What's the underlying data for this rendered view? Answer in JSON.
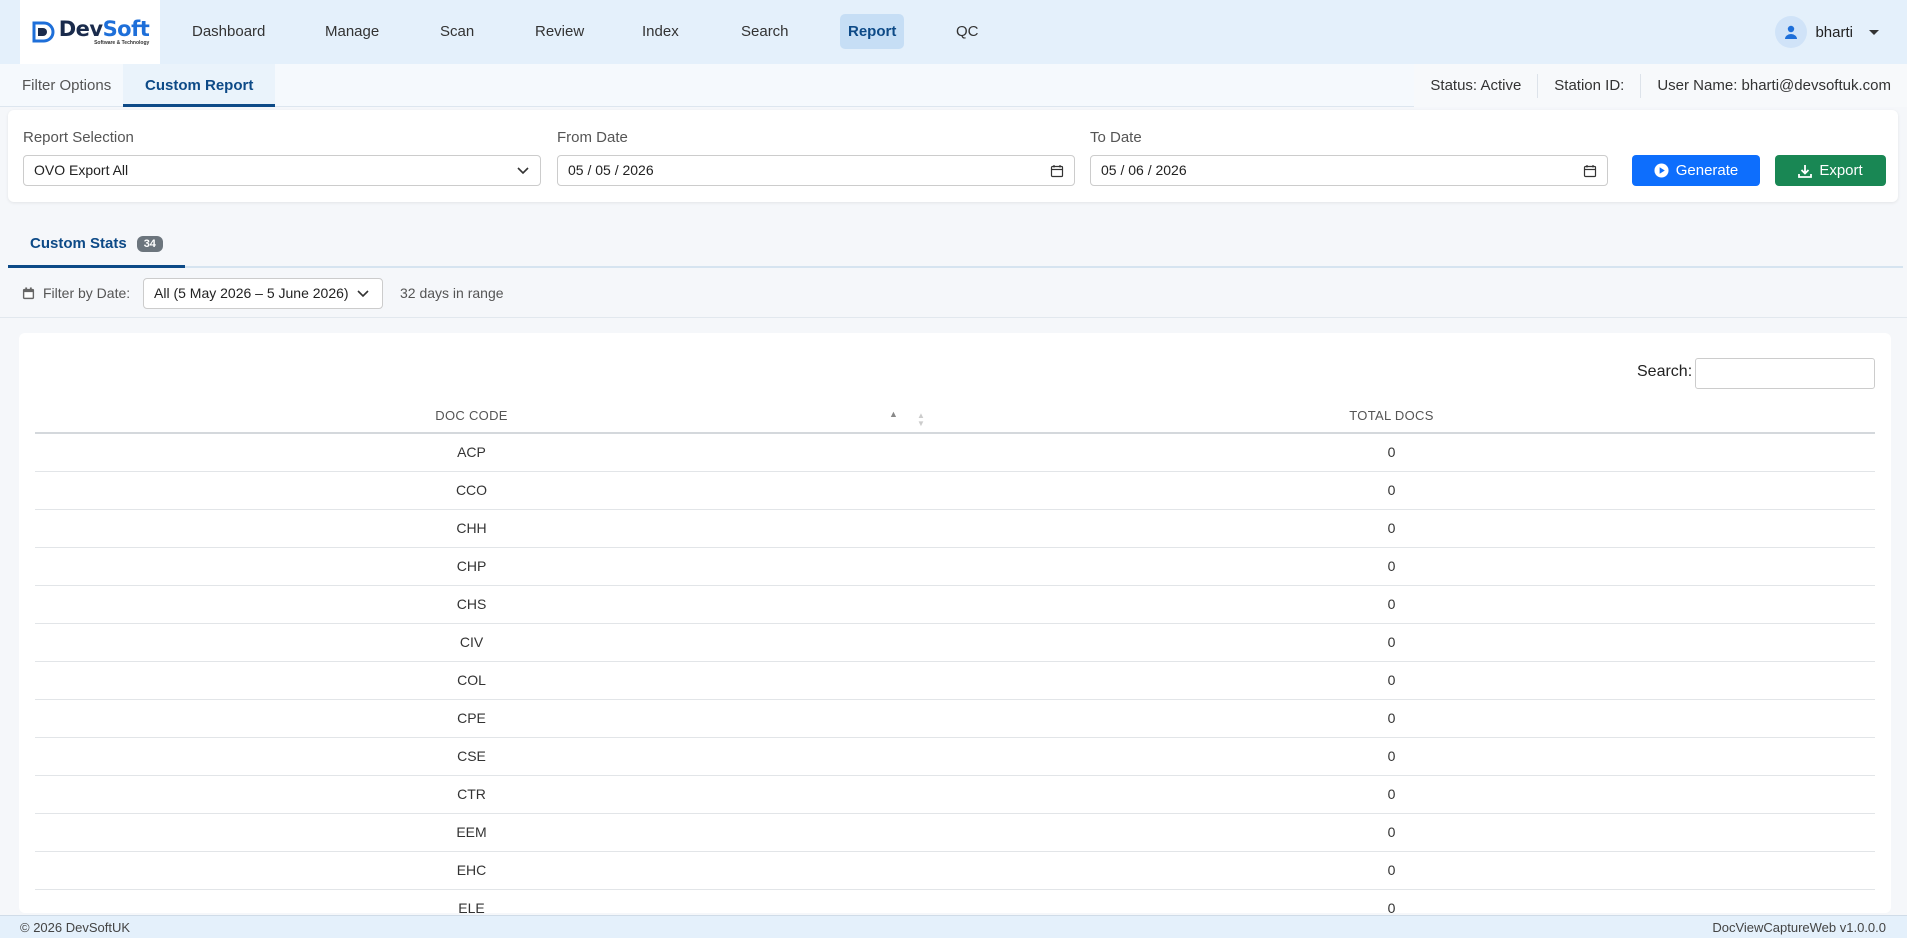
{
  "brand": {
    "logo_title_a": "Dev",
    "logo_title_b": "Soft",
    "logo_sub": "Software & Technology"
  },
  "nav": {
    "items": [
      "Dashboard",
      "Manage",
      "Scan",
      "Review",
      "Index",
      "Search",
      "Report",
      "QC"
    ],
    "active": "Report"
  },
  "user": {
    "name": "bharti"
  },
  "subtabs": [
    "Filter Options",
    "Custom Report"
  ],
  "status": {
    "status": "Status: Active",
    "station": "Station ID:",
    "username": "User Name: bharti@devsoftuk.com"
  },
  "filters": {
    "report_label": "Report Selection",
    "report_value": "OVO Export All",
    "from_label": "From Date",
    "from_value": "05 / 05 / 2026",
    "to_label": "To Date",
    "to_value": "05 / 06 / 2026",
    "generate_label": "Generate",
    "export_label": "Export"
  },
  "stats": {
    "tab_label": "Custom Stats",
    "count": "34"
  },
  "date_filter": {
    "label": "Filter by Date:",
    "value": "All (5 May 2026 – 5 June 2026)",
    "range": "32 days in range"
  },
  "table": {
    "search_label": "Search:",
    "headers": [
      "DOC CODE",
      "TOTAL DOCS"
    ],
    "rows": [
      {
        "code": "ACP",
        "total": "0"
      },
      {
        "code": "CCO",
        "total": "0"
      },
      {
        "code": "CHH",
        "total": "0"
      },
      {
        "code": "CHP",
        "total": "0"
      },
      {
        "code": "CHS",
        "total": "0"
      },
      {
        "code": "CIV",
        "total": "0"
      },
      {
        "code": "COL",
        "total": "0"
      },
      {
        "code": "CPE",
        "total": "0"
      },
      {
        "code": "CSE",
        "total": "0"
      },
      {
        "code": "CTR",
        "total": "0"
      },
      {
        "code": "EEM",
        "total": "0"
      },
      {
        "code": "EHC",
        "total": "0"
      },
      {
        "code": "ELE",
        "total": "0"
      }
    ]
  },
  "footer": {
    "left": "© 2026 DevSoftUK",
    "right": "DocViewCaptureWeb v1.0.0.0"
  },
  "colors": {
    "primary": "#0d6efd",
    "success": "#198754",
    "nav_bg": "#e4f0fb",
    "accent": "#0d4a87"
  }
}
